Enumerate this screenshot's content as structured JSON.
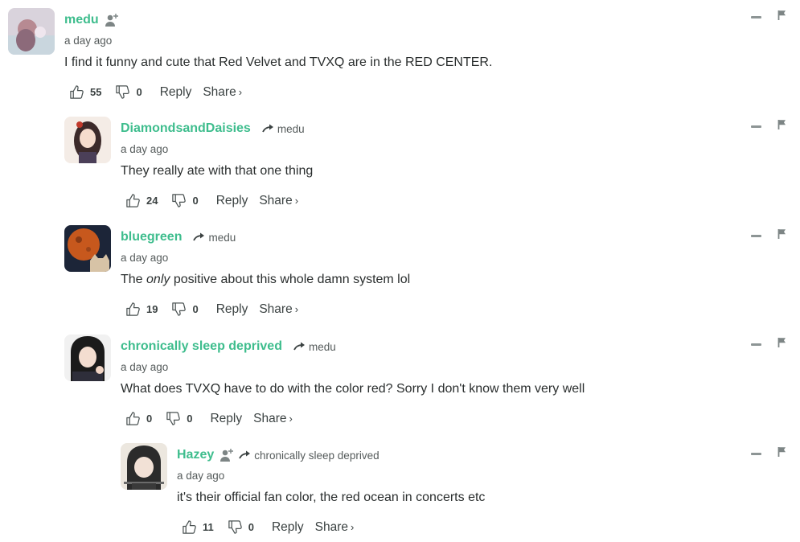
{
  "comments": [
    {
      "author": "medu",
      "reply_to": "",
      "time": "a day ago",
      "text_before": "I find it funny and cute that Red Velvet and TVXQ are in the RED CENTER.",
      "text_em": "",
      "text_after": "",
      "likes": "55",
      "dislikes": "0",
      "has_follow": true
    },
    {
      "author": "DiamondsandDaisies",
      "reply_to": "medu",
      "time": "a day ago",
      "text_before": "They really ate with that one thing",
      "text_em": "",
      "text_after": "",
      "likes": "24",
      "dislikes": "0",
      "has_follow": false
    },
    {
      "author": "bluegreen",
      "reply_to": "medu",
      "time": "a day ago",
      "text_before": "The ",
      "text_em": "only",
      "text_after": " positive about this whole damn system lol",
      "likes": "19",
      "dislikes": "0",
      "has_follow": false
    },
    {
      "author": "chronically sleep deprived",
      "reply_to": "medu",
      "time": "a day ago",
      "text_before": "What does TVXQ have to do with the color red? Sorry I don't know them very well",
      "text_em": "",
      "text_after": "",
      "likes": "0",
      "dislikes": "0",
      "has_follow": false
    },
    {
      "author": "Hazey",
      "reply_to": "chronically sleep deprived",
      "time": "a day ago",
      "text_before": "it's their official fan color, the red ocean in concerts etc",
      "text_em": "",
      "text_after": "",
      "likes": "11",
      "dislikes": "0",
      "has_follow": true
    }
  ],
  "labels": {
    "reply": "Reply",
    "share": "Share",
    "share_chevron": "›"
  },
  "colors": {
    "author": "#3ebd8d",
    "text": "#2a2e2e",
    "meta": "#555b5b",
    "icon": "#8d9595"
  },
  "icons": [
    "follow-user-icon",
    "reply-arrow-icon",
    "thumbs-up-icon",
    "thumbs-down-icon",
    "collapse-icon",
    "flag-icon"
  ]
}
